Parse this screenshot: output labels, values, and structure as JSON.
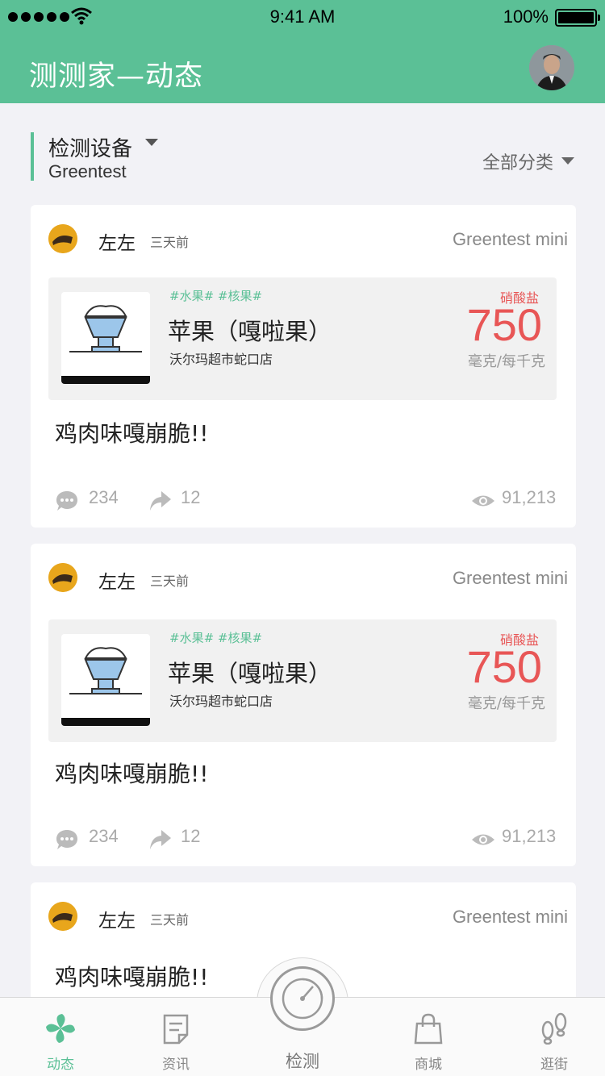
{
  "status_bar": {
    "time": "9:41 AM",
    "battery": "100%"
  },
  "header": {
    "title": "测测家—动态"
  },
  "filter": {
    "device_label": "检测设备",
    "device_name": "Greentest",
    "category": "全部分类"
  },
  "posts": [
    {
      "user": "左左",
      "time": "三天前",
      "device": "Greentest mini",
      "tags": "#水果# #核果#",
      "food": "苹果（嘎啦果）",
      "store": "沃尔玛超市蛇口店",
      "metric": "硝酸盐",
      "value": "750",
      "unit": "毫克/每千克",
      "content": "鸡肉味嘎崩脆!!",
      "comments": "234",
      "shares": "12",
      "views": "91,213"
    },
    {
      "user": "左左",
      "time": "三天前",
      "device": "Greentest mini",
      "tags": "#水果# #核果#",
      "food": "苹果（嘎啦果）",
      "store": "沃尔玛超市蛇口店",
      "metric": "硝酸盐",
      "value": "750",
      "unit": "毫克/每千克",
      "content": "鸡肉味嘎崩脆!!",
      "comments": "234",
      "shares": "12",
      "views": "91,213"
    },
    {
      "user": "左左",
      "time": "三天前",
      "device": "Greentest mini",
      "content": "鸡肉味嘎崩脆!!"
    }
  ],
  "tabbar": {
    "items": [
      {
        "label": "动态",
        "icon": "fan-icon"
      },
      {
        "label": "资讯",
        "icon": "document-icon"
      },
      {
        "label": "检测",
        "icon": "radar-icon"
      },
      {
        "label": "商城",
        "icon": "shopping-bag-icon"
      },
      {
        "label": "逛街",
        "icon": "footprints-icon"
      }
    ]
  },
  "colors": {
    "accent": "#5bc096",
    "value": "#e85656"
  }
}
